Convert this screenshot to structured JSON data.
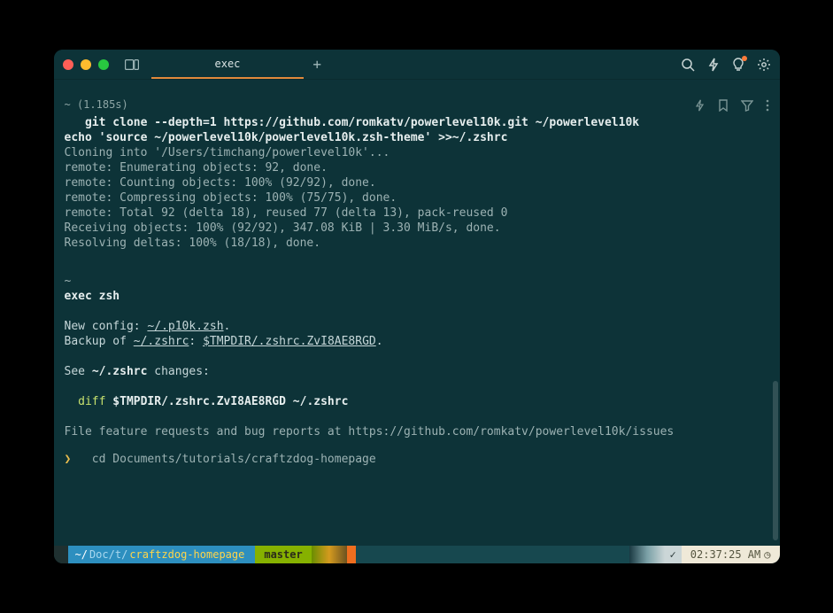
{
  "tabs": {
    "active": "exec"
  },
  "block1": {
    "meta": "~ (1.185s)",
    "cmd_line1": "   git clone --depth=1 https://github.com/romkatv/powerlevel10k.git ~/powerlevel10k",
    "cmd_line2": "echo 'source ~/powerlevel10k/powerlevel10k.zsh-theme' >>~/.zshrc",
    "out": [
      "Cloning into '/Users/timchang/powerlevel10k'...",
      "remote: Enumerating objects: 92, done.",
      "remote: Counting objects: 100% (92/92), done.",
      "remote: Compressing objects: 100% (75/75), done.",
      "remote: Total 92 (delta 18), reused 77 (delta 13), pack-reused 0",
      "Receiving objects: 100% (92/92), 347.08 KiB | 3.30 MiB/s, done.",
      "Resolving deltas: 100% (18/18), done."
    ]
  },
  "block2": {
    "meta": "~",
    "cmd": "exec zsh",
    "newconfig_label": "New config: ",
    "newconfig_path": "~/.p10k.zsh",
    "newconfig_tail": ".",
    "backup_label": "Backup of ",
    "backup_path1": "~/.zshrc",
    "backup_sep": ": ",
    "backup_path2": "$TMPDIR/.zshrc.ZvI8AE8RGD",
    "backup_tail": ".",
    "see_pre": "See ",
    "see_path": "~/.zshrc",
    "see_post": " changes:",
    "diff_kw": "diff",
    "diff_args": " $TMPDIR/.zshrc.ZvI8AE8RGD ~/.zshrc",
    "issues": "File feature requests and bug reports at https://github.com/romkatv/powerlevel10k/issues",
    "prompt_lead": "❯",
    "prompt_cmd": "   cd Documents/tutorials/craftzdog-homepage"
  },
  "status": {
    "apple": "",
    "path_home": " ~/",
    "path_mid": "Doc/t/",
    "path_tail": "craftzdog-homepage ",
    "git": "  master ",
    "check": "✓ ",
    "time": "02:37:25 AM ",
    "clock": "◷"
  }
}
